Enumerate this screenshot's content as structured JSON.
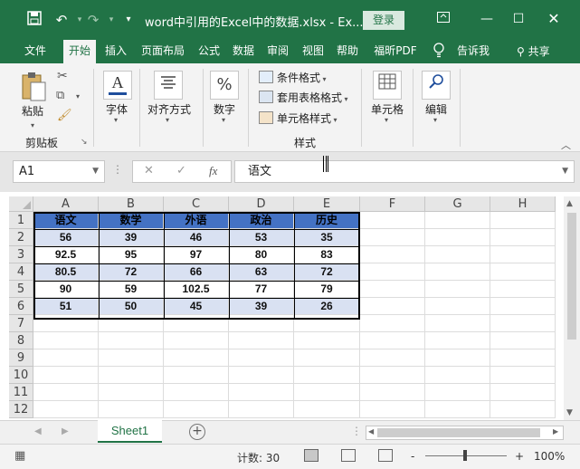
{
  "title_bar": {
    "doc_title": "word中引用的Excel中的数据.xlsx  -  Ex...",
    "login_label": "登录",
    "icons": [
      "save-icon",
      "undo-icon",
      "redo-icon",
      "customize-icon",
      "ribbon-display-icon",
      "minimize-icon",
      "restore-icon",
      "close-icon"
    ]
  },
  "menu": {
    "tabs": [
      "文件",
      "开始",
      "插入",
      "页面布局",
      "公式",
      "数据",
      "审阅",
      "视图",
      "帮助",
      "福昕PDF",
      "告诉我"
    ],
    "active_tab": "开始",
    "share_label": "共享"
  },
  "ribbon": {
    "paste_label": "粘贴",
    "clipboard_group": "剪贴板",
    "font_label": "字体",
    "align_label": "对齐方式",
    "number_label": "数字",
    "cond_format": "条件格式",
    "table_format": "套用表格格式",
    "cell_styles": "单元格样式",
    "styles_group": "样式",
    "cells_label": "单元格",
    "edit_label": "编辑",
    "number_icon_text": "%"
  },
  "formula_bar": {
    "name_box": "A1",
    "content": "语文",
    "fx_label": "fx"
  },
  "grid": {
    "columns": [
      "A",
      "B",
      "C",
      "D",
      "E",
      "F",
      "G",
      "H"
    ],
    "rows": [
      "1",
      "2",
      "3",
      "4",
      "5",
      "6",
      "7",
      "8",
      "9",
      "10",
      "11",
      "12"
    ],
    "header_fill": "#4472c4",
    "band_fill": "#d9e1f2",
    "table": [
      [
        "语文",
        "数学",
        "外语",
        "政治",
        "历史"
      ],
      [
        "56",
        "39",
        "46",
        "53",
        "35"
      ],
      [
        "92.5",
        "95",
        "97",
        "80",
        "83"
      ],
      [
        "80.5",
        "72",
        "66",
        "63",
        "72"
      ],
      [
        "90",
        "59",
        "102.5",
        "77",
        "79"
      ],
      [
        "51",
        "50",
        "45",
        "39",
        "26"
      ]
    ]
  },
  "sheets": {
    "active": "Sheet1"
  },
  "status": {
    "count_label": "计数: 30",
    "zoom": "100%",
    "minus": "-",
    "plus": "+"
  }
}
